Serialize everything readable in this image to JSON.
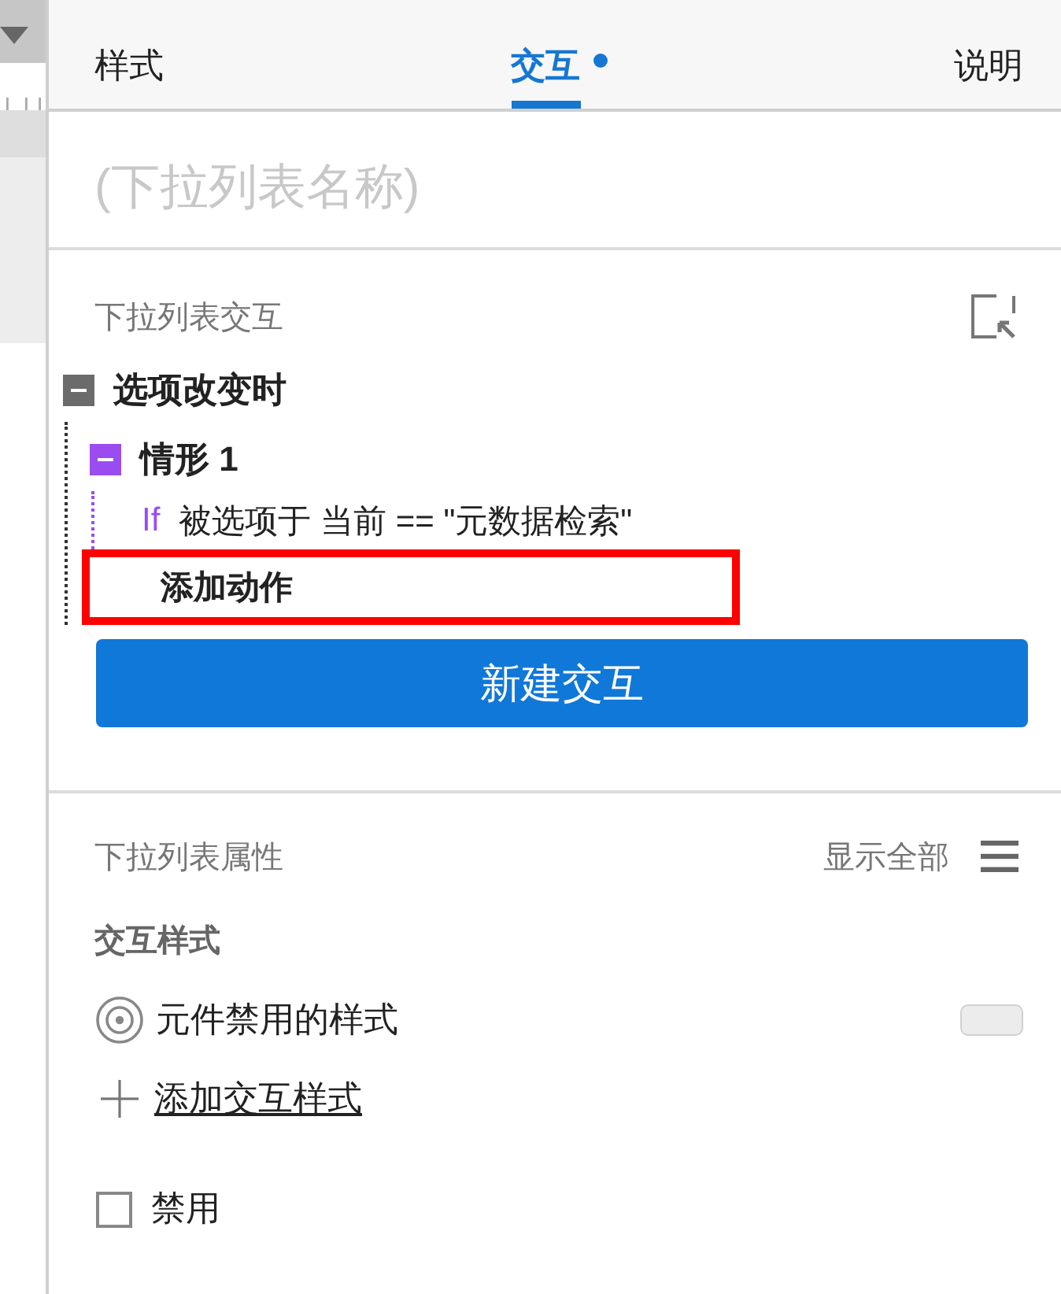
{
  "tabs": [
    {
      "label": "样式",
      "selected": false,
      "dot": false
    },
    {
      "label": "交互",
      "selected": true,
      "dot": true
    },
    {
      "label": "说明",
      "selected": false,
      "dot": false
    }
  ],
  "name_field": {
    "placeholder": "(下拉列表名称)"
  },
  "interactions": {
    "heading": "下拉列表交互",
    "events": [
      {
        "label": "选项改变时",
        "expanded": true,
        "cases": [
          {
            "label": "情形 1",
            "expanded": true,
            "condition": {
              "keyword": "If",
              "text": "被选项于 当前 == \"元数据检索\""
            },
            "actions": [
              {
                "label": "添加动作",
                "highlighted": true
              }
            ]
          }
        ]
      }
    ],
    "new_button": "新建交互"
  },
  "properties": {
    "heading": "下拉列表属性",
    "show_all": "显示全部",
    "styles_heading": "交互样式",
    "styles": [
      {
        "label": "元件禁用的样式"
      }
    ],
    "add_style_link": "添加交互样式",
    "checkboxes": [
      {
        "label": "禁用",
        "checked": false
      }
    ]
  }
}
